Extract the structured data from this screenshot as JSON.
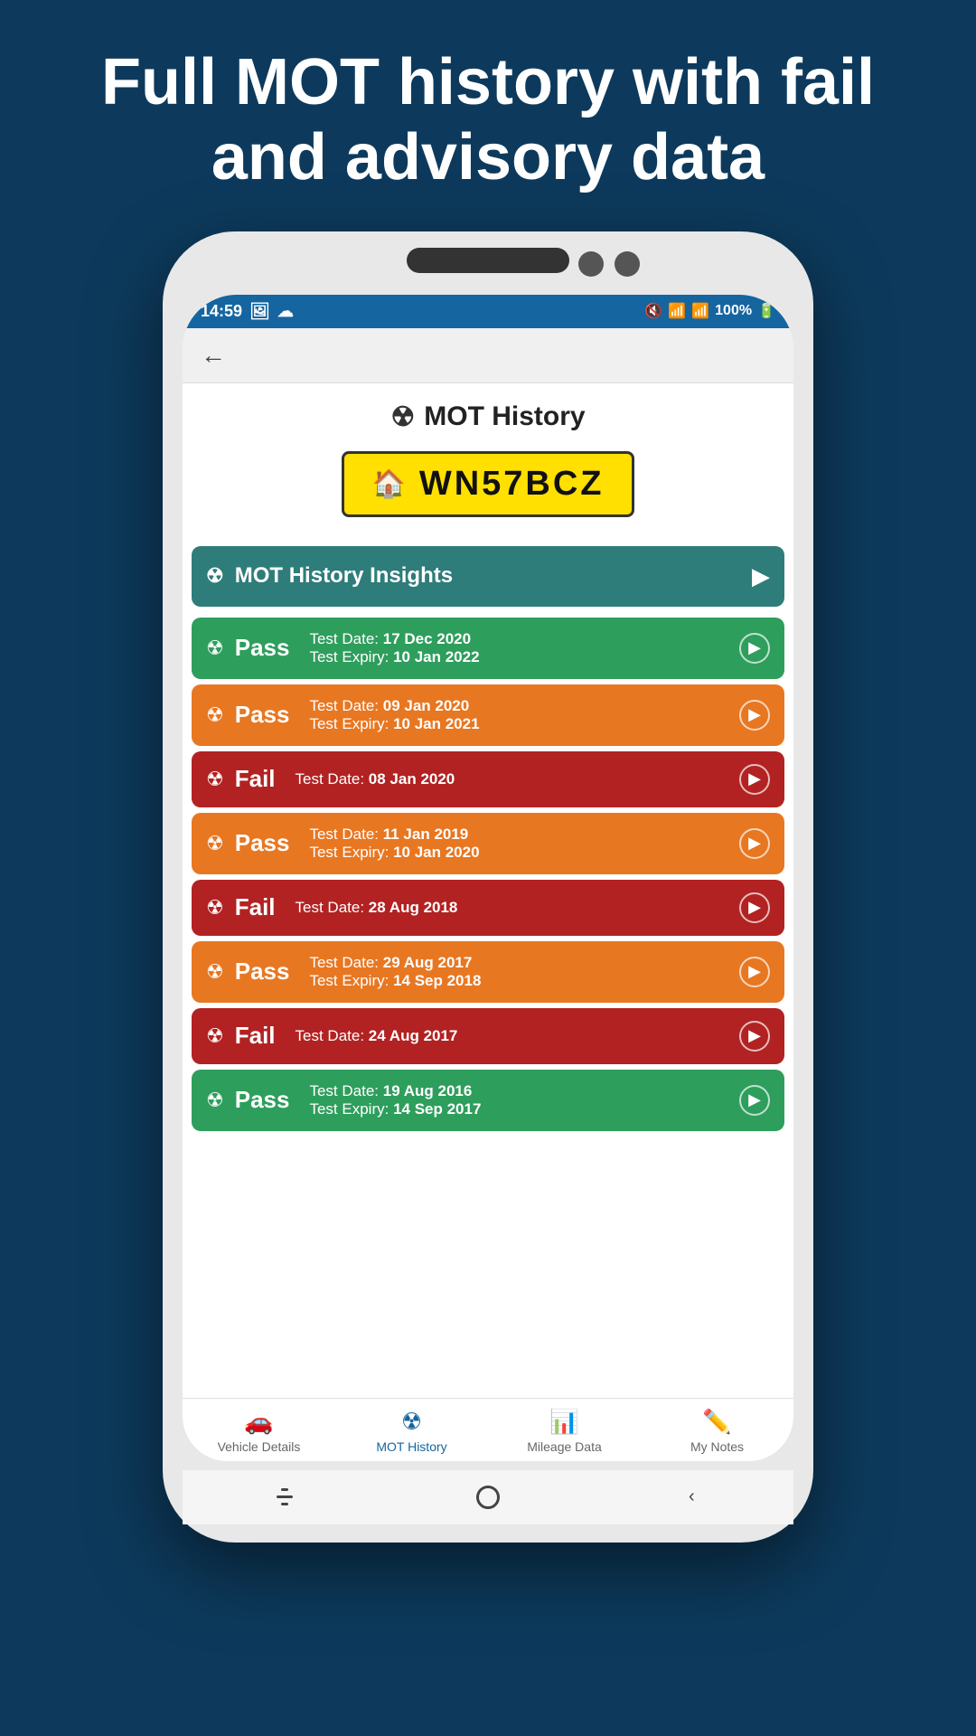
{
  "hero": {
    "title": "Full MOT history with fail and advisory data"
  },
  "status_bar": {
    "time": "14:59",
    "battery": "100%"
  },
  "page": {
    "title": "MOT History",
    "plate": "WN57BCZ"
  },
  "insights": {
    "label": "MOT History Insights"
  },
  "mot_items": [
    {
      "status": "Pass",
      "color_class": "pass-green",
      "test_date_label": "Test Date:",
      "test_date_value": "17 Dec 2020",
      "expiry_label": "Test Expiry:",
      "expiry_value": "10 Jan 2022",
      "has_expiry": true
    },
    {
      "status": "Pass",
      "color_class": "pass-orange",
      "test_date_label": "Test Date:",
      "test_date_value": "09 Jan 2020",
      "expiry_label": "Test Expiry:",
      "expiry_value": "10 Jan 2021",
      "has_expiry": true
    },
    {
      "status": "Fail",
      "color_class": "fail-red",
      "test_date_label": "Test Date:",
      "test_date_value": "08 Jan 2020",
      "expiry_label": "",
      "expiry_value": "",
      "has_expiry": false
    },
    {
      "status": "Pass",
      "color_class": "pass-orange",
      "test_date_label": "Test Date:",
      "test_date_value": "11 Jan 2019",
      "expiry_label": "Test Expiry:",
      "expiry_value": "10 Jan 2020",
      "has_expiry": true
    },
    {
      "status": "Fail",
      "color_class": "fail-red",
      "test_date_label": "Test Date:",
      "test_date_value": "28 Aug 2018",
      "expiry_label": "",
      "expiry_value": "",
      "has_expiry": false
    },
    {
      "status": "Pass",
      "color_class": "pass-orange",
      "test_date_label": "Test Date:",
      "test_date_value": "29 Aug 2017",
      "expiry_label": "Test Expiry:",
      "expiry_value": "14 Sep 2018",
      "has_expiry": true
    },
    {
      "status": "Fail",
      "color_class": "fail-red",
      "test_date_label": "Test Date:",
      "test_date_value": "24 Aug 2017",
      "expiry_label": "",
      "expiry_value": "",
      "has_expiry": false
    },
    {
      "status": "Pass",
      "color_class": "pass-green",
      "test_date_label": "Test Date:",
      "test_date_value": "19 Aug 2016",
      "expiry_label": "Test Expiry:",
      "expiry_value": "14 Sep 2017",
      "has_expiry": true
    }
  ],
  "bottom_nav": {
    "items": [
      {
        "id": "vehicle-details",
        "label": "Vehicle Details",
        "icon": "🚗",
        "active": false
      },
      {
        "id": "mot-history",
        "label": "MOT History",
        "icon": "☢",
        "active": true
      },
      {
        "id": "mileage-data",
        "label": "Mileage Data",
        "icon": "📊",
        "active": false
      },
      {
        "id": "my-notes",
        "label": "My Notes",
        "icon": "✏️",
        "active": false
      }
    ]
  }
}
